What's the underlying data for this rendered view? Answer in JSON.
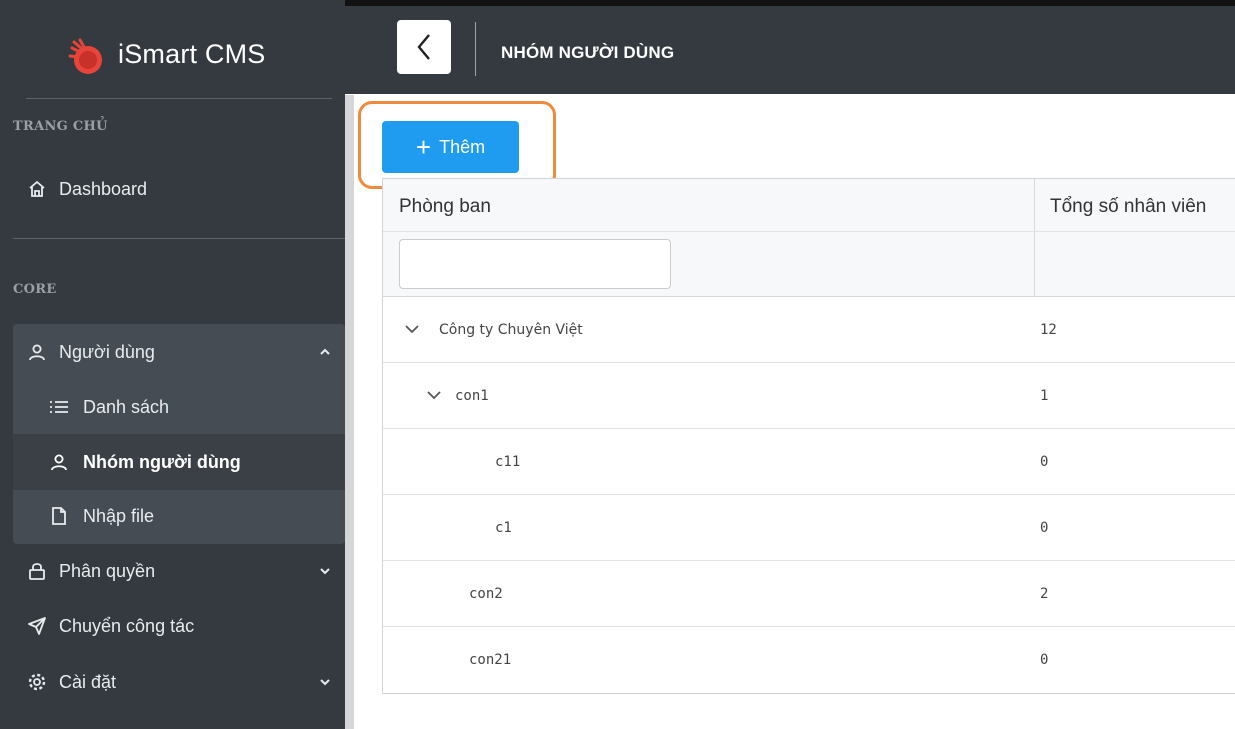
{
  "app": {
    "title": "iSmart CMS"
  },
  "header": {
    "page_title": "NHÓM NGƯỜI DÙNG"
  },
  "sidebar": {
    "sections": [
      {
        "heading": "TRANG CHỦ"
      },
      {
        "heading": "CORE"
      }
    ],
    "dashboard": {
      "label": "Dashboard",
      "icon": "home-icon"
    },
    "users_group": {
      "label": "Người dùng",
      "icon": "user-icon",
      "expanded": true,
      "items": [
        {
          "label": "Danh sách",
          "icon": "list-icon"
        },
        {
          "label": "Nhóm người dùng",
          "icon": "user-icon",
          "active": true
        },
        {
          "label": "Nhập file",
          "icon": "file-icon"
        }
      ]
    },
    "permissions": {
      "label": "Phân quyền",
      "icon": "lock-icon"
    },
    "transfer": {
      "label": "Chuyển công tác",
      "icon": "send-icon"
    },
    "settings": {
      "label": "Cài đặt",
      "icon": "gear-icon"
    }
  },
  "toolbar": {
    "add_label": "Thêm",
    "add_icon": "plus-icon",
    "highlight_color": "#f08a3c",
    "button_color": "#1f9bf0"
  },
  "table": {
    "columns": [
      "Phòng ban",
      "Tổng số nhân viên"
    ],
    "filter": {
      "value": "",
      "placeholder": ""
    },
    "rows": [
      {
        "name": "Công ty Chuyên Việt",
        "count": "12",
        "level": 0,
        "expanded": true
      },
      {
        "name": "con1",
        "count": "1",
        "level": 1,
        "expanded": true
      },
      {
        "name": "c11",
        "count": "0",
        "level": 2
      },
      {
        "name": "c1",
        "count": "0",
        "level": 2
      },
      {
        "name": "con2",
        "count": "2",
        "level": 1
      },
      {
        "name": "con21",
        "count": "0",
        "level": 1
      }
    ]
  }
}
